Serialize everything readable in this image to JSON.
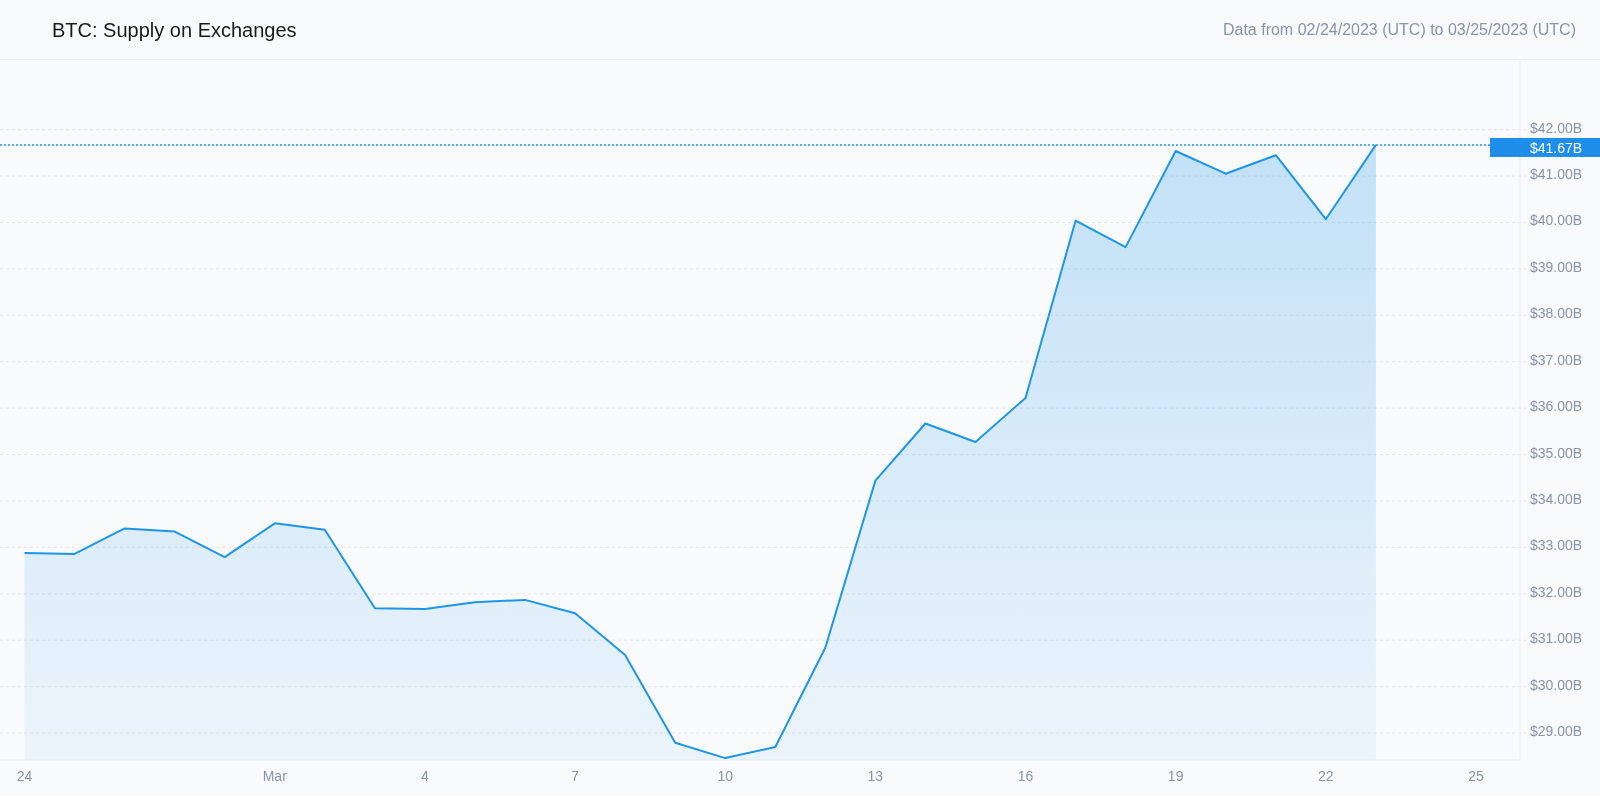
{
  "header": {
    "title": "BTC: Supply on Exchanges",
    "date_range": "Data from 02/24/2023 (UTC) to 03/25/2023 (UTC)"
  },
  "chart": {
    "chart_data": {
      "type": "area",
      "grid": true,
      "ref_lines": [
        {
          "axis": "y",
          "value": 41.67,
          "label": "$41.67B"
        }
      ],
      "categories": [
        "24",
        null,
        null,
        null,
        null,
        "Mar",
        null,
        null,
        "4",
        null,
        null,
        "7",
        null,
        null,
        "10",
        null,
        null,
        "13",
        null,
        null,
        "16",
        null,
        null,
        "19",
        null,
        null,
        "22",
        null,
        null,
        "25"
      ],
      "series": [
        {
          "color": "#1e96e8",
          "values": [
            32.88,
            32.86,
            33.41,
            33.34,
            32.79,
            33.52,
            33.38,
            31.69,
            31.67,
            31.82,
            31.87,
            31.58,
            30.68,
            28.79,
            28.46,
            28.7,
            30.84,
            34.44,
            35.67,
            35.27,
            36.22,
            40.04,
            39.47,
            41.54,
            41.05,
            41.45,
            40.07,
            41.67,
            null,
            null
          ]
        }
      ],
      "ylim": [
        28.42,
        43.5
      ],
      "yticks": [
        {
          "value": 29,
          "label": "$29.00B"
        },
        {
          "value": 30,
          "label": "$30.00B"
        },
        {
          "value": 31,
          "label": "$31.00B"
        },
        {
          "value": 32,
          "label": "$32.00B"
        },
        {
          "value": 33,
          "label": "$33.00B"
        },
        {
          "value": 34,
          "label": "$34.00B"
        },
        {
          "value": 35,
          "label": "$35.00B"
        },
        {
          "value": 36,
          "label": "$36.00B"
        },
        {
          "value": 37,
          "label": "$37.00B"
        },
        {
          "value": 38,
          "label": "$38.00B"
        },
        {
          "value": 39,
          "label": "$39.00B"
        },
        {
          "value": 40,
          "label": "$40.00B"
        },
        {
          "value": 41,
          "label": "$41.00B"
        },
        {
          "value": 42,
          "label": "$42.00B"
        }
      ]
    }
  }
}
